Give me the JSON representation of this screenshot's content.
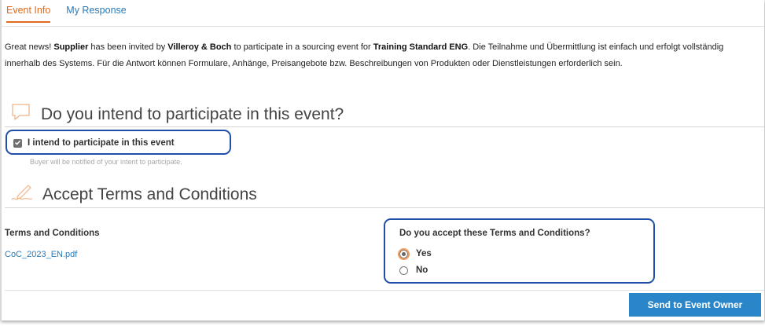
{
  "tabs": [
    {
      "label": "Event Info",
      "active": true
    },
    {
      "label": "My Response",
      "active": false
    }
  ],
  "intro": {
    "pre": "Great news! ",
    "supplier": "Supplier",
    "mid1": " has been invited by ",
    "buyer": "Villeroy & Boch",
    "mid2": " to participate in a sourcing event for ",
    "event": "Training Standard ENG",
    "post": ". Die Teilnahme und Übermittlung ist einfach und erfolgt vollständig innerhalb des Systems. Für die Antwort können Formulare, Anhänge, Preisangebote bzw. Beschreibungen von Produkten oder Dienstleistungen erforderlich sein."
  },
  "participate": {
    "title": "Do you intend to participate in this event?",
    "checkbox_label": "I intend to participate in this event",
    "checked": true,
    "hint": "Buyer will be notified of your intent to participate."
  },
  "terms": {
    "title": "Accept Terms and Conditions",
    "label": "Terms and Conditions",
    "file": "CoC_2023_EN.pdf",
    "question": "Do you accept these Terms and Conditions?",
    "options": [
      {
        "label": "Yes",
        "selected": true
      },
      {
        "label": "No",
        "selected": false
      }
    ]
  },
  "actions": {
    "send_label": "Send to Event Owner"
  },
  "colors": {
    "accent": "#e06a1c",
    "link": "#2a7ab8",
    "button": "#2a86c8",
    "highlight": "#1f4fa8"
  },
  "icons": {
    "participate": "speech-bubble-icon",
    "terms": "signature-pen-icon",
    "checkbox": "checkmark-icon"
  }
}
